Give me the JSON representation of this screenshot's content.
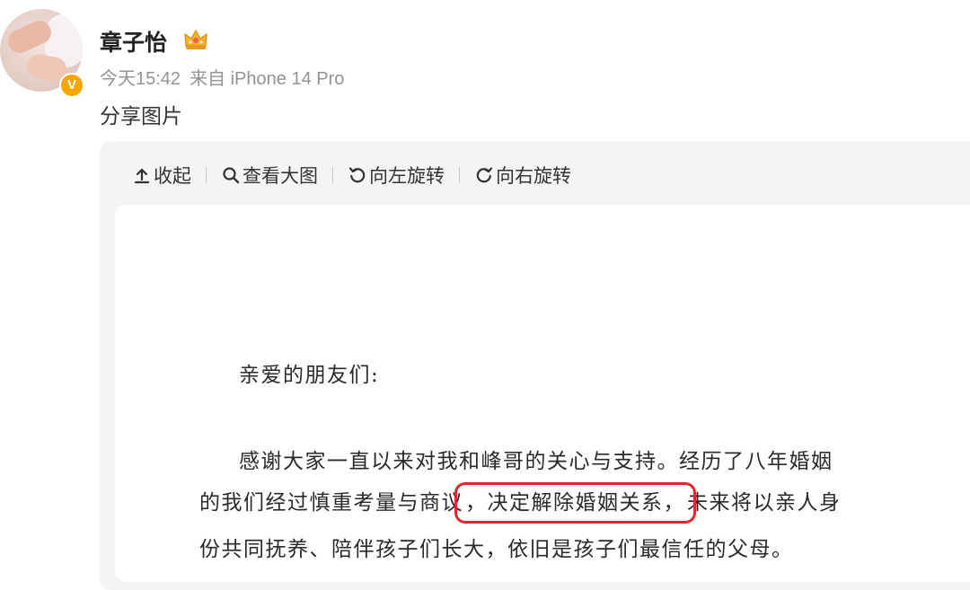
{
  "user": {
    "name": "章子怡",
    "verified_badge": "V",
    "time": "今天15:42",
    "source": "来自 iPhone 14 Pro"
  },
  "post": {
    "text": "分享图片"
  },
  "toolbar": {
    "collapse_label": "收起",
    "view_large_label": "查看大图",
    "rotate_left_label": "向左旋转",
    "rotate_right_label": "向右旋转"
  },
  "letter": {
    "greeting": "亲爱的朋友们:",
    "line1": "感谢大家一直以来对我和峰哥的关心与支持。经历了八年婚姻",
    "line2_before": "的我们经过慎重考量与商议",
    "line2_highlight": "，决定解除婚姻关系，",
    "line2_after": "未来将以亲人身",
    "line3": "份共同抚养、陪伴孩子们长大，依旧是孩子们最信任的父母。"
  },
  "colors": {
    "verified": "#f7a600",
    "highlight_box": "#e5262a",
    "meta_text": "#939393"
  },
  "icons": [
    "collapse-icon",
    "search-icon",
    "rotate-left-icon",
    "rotate-right-icon",
    "crown-icon"
  ]
}
